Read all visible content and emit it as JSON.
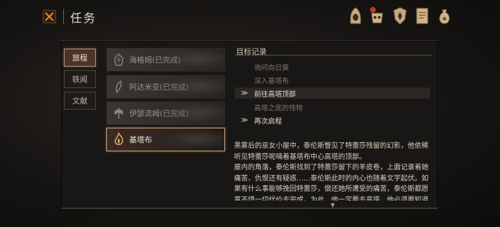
{
  "header": {
    "title": "任务"
  },
  "top_icons": [
    "hood-mask-icon",
    "skull-gear-icon",
    "shield-crest-icon",
    "journal-icon",
    "pouch-icon"
  ],
  "tabs": [
    {
      "label": "旅程",
      "active": true
    },
    {
      "label": "轶闻",
      "active": false
    },
    {
      "label": "文献",
      "active": false
    }
  ],
  "quests": [
    {
      "label": "海格姆(已完成)",
      "icon": "helm-rune-icon",
      "active": false
    },
    {
      "label": "阿达米亚(已完成)",
      "icon": "feather-icon",
      "active": false
    },
    {
      "label": "伊瑟流姆(已完成)",
      "icon": "axe-icon",
      "active": false
    },
    {
      "label": "基塔布",
      "icon": "flame-icon",
      "active": true
    }
  ],
  "objectives": {
    "heading": "目标记录",
    "items": [
      {
        "text": "询问向日葵",
        "status": "done",
        "arrow": ""
      },
      {
        "text": "深入基塔布",
        "status": "done",
        "arrow": ""
      },
      {
        "text": "前往高塔顶部",
        "status": "current",
        "arrow": "≫"
      },
      {
        "text": "高塔之底的怪物",
        "status": "done",
        "arrow": ""
      },
      {
        "text": "再次启程",
        "status": "current",
        "arrow": "≫"
      }
    ]
  },
  "description": [
    "黑雾后的巫女小屋中，泰伦斯瞥见了特蕾莎残留的幻影，他依稀听见特蕾莎呢喃着基塔布中心高塔的顶部。",
    "屋内的角落，泰伦斯找到了特蕾莎留下的羊皮卷，上面记录着她痛苦、仇恨还有疑惑……泰伦斯此时的内心也随着文字起伏。如果有什么事能够挽回特蕾莎，偿还她所遭受的痛苦，泰伦斯都愿意不惜一切代价去完成。为此，他一定要去高塔，他必须要知道特蕾莎来"
  ],
  "colors": {
    "accent": "#c7a27a",
    "active_tab": "#4a342c",
    "close_x": "#e08a2a"
  }
}
